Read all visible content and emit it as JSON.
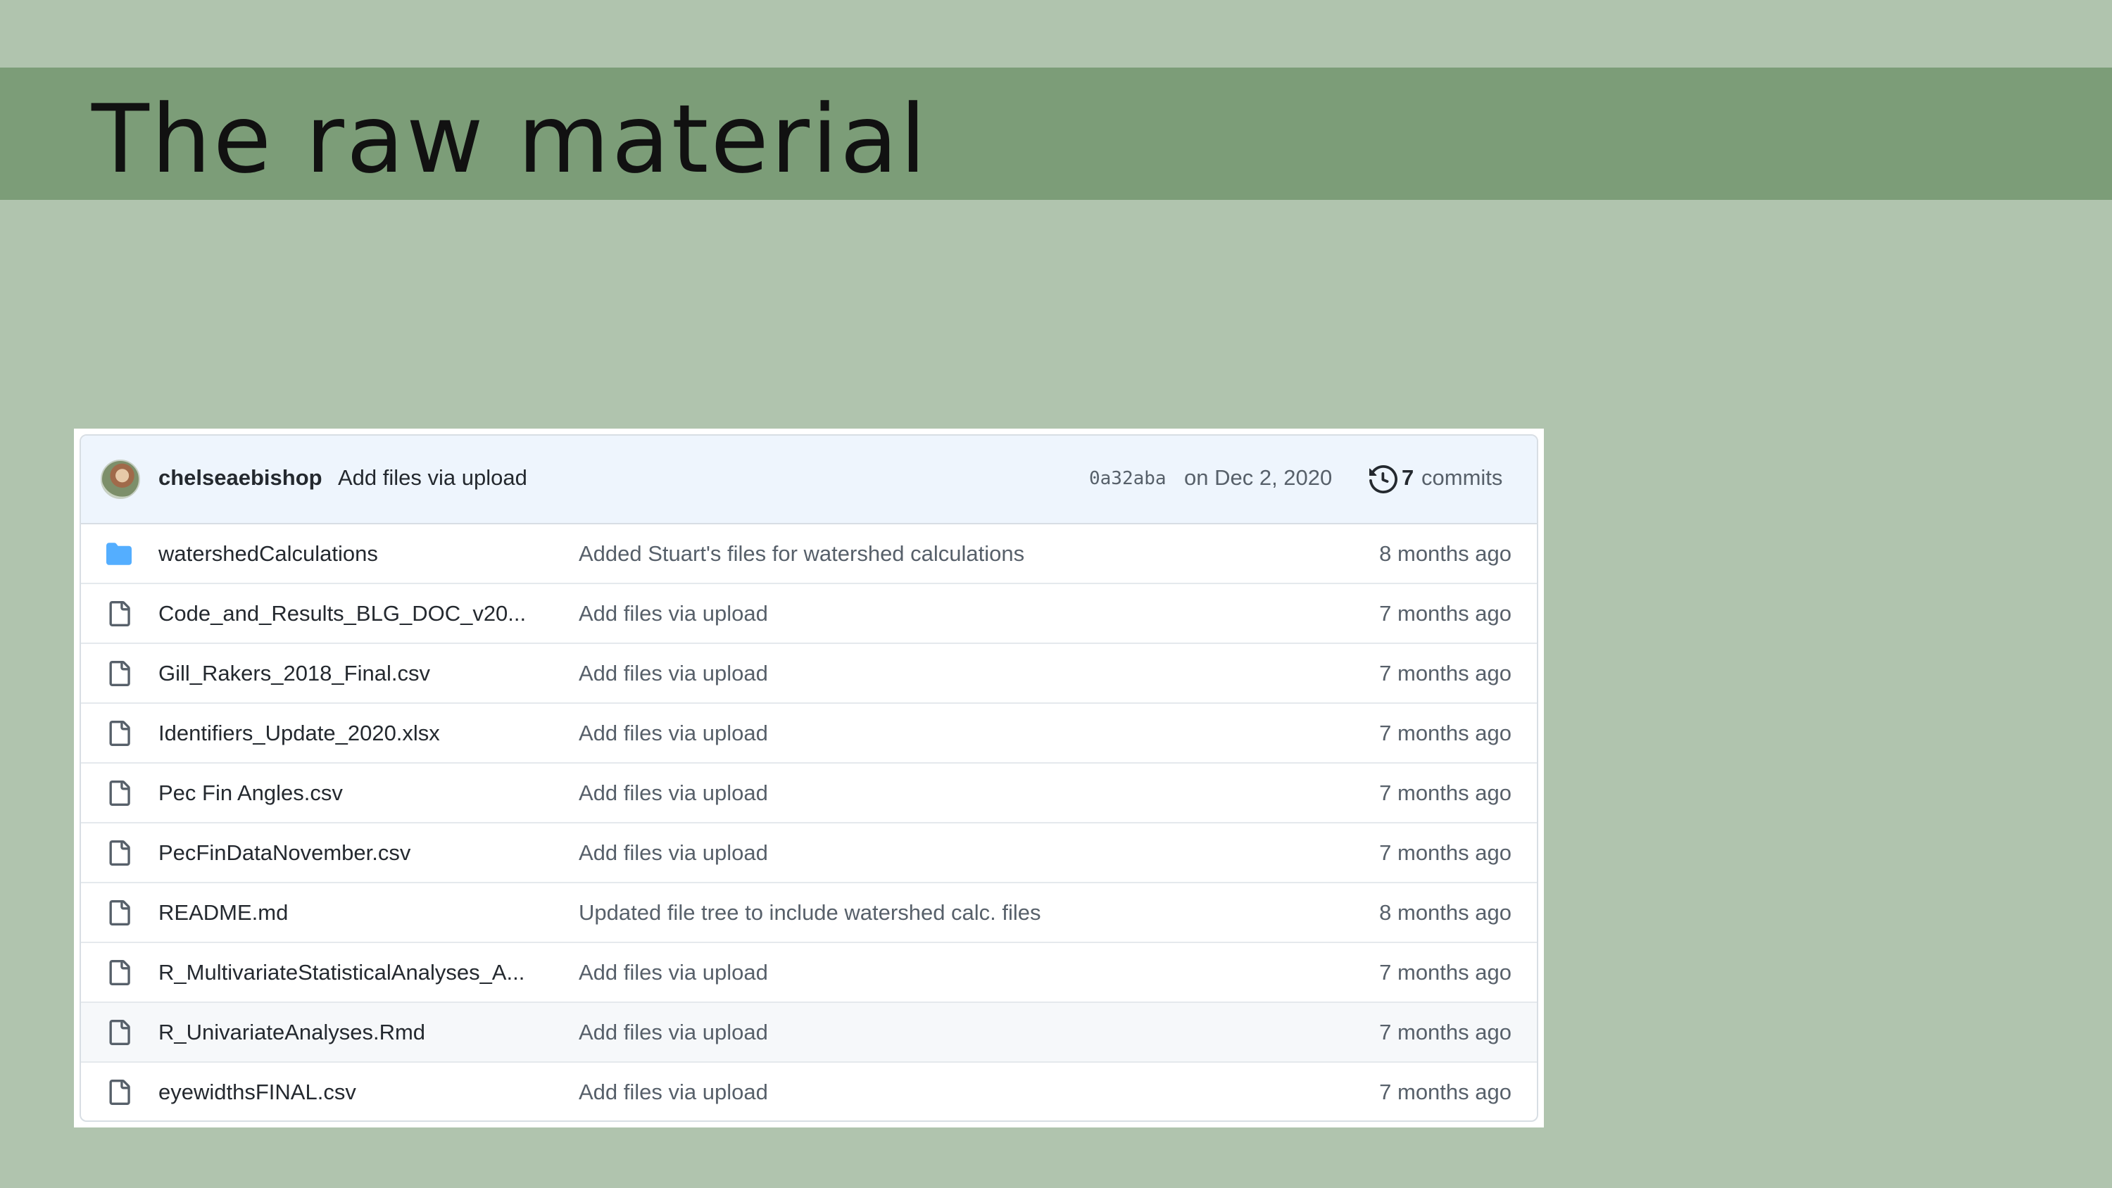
{
  "slide": {
    "title": "The raw material"
  },
  "commit": {
    "author": "chelseaebishop",
    "message": "Add files via upload",
    "hash": "0a32aba",
    "date": "on Dec 2, 2020",
    "commit_count": "7",
    "commit_count_label": "commits"
  },
  "files": [
    {
      "name": "watershedCalculations",
      "type": "folder",
      "message": "Added Stuart's files for watershed calculations",
      "age": "8 months ago"
    },
    {
      "name": "Code_and_Results_BLG_DOC_v20...",
      "type": "file",
      "message": "Add files via upload",
      "age": "7 months ago"
    },
    {
      "name": "Gill_Rakers_2018_Final.csv",
      "type": "file",
      "message": "Add files via upload",
      "age": "7 months ago"
    },
    {
      "name": "Identifiers_Update_2020.xlsx",
      "type": "file",
      "message": "Add files via upload",
      "age": "7 months ago"
    },
    {
      "name": "Pec Fin Angles.csv",
      "type": "file",
      "message": "Add files via upload",
      "age": "7 months ago"
    },
    {
      "name": "PecFinDataNovember.csv",
      "type": "file",
      "message": "Add files via upload",
      "age": "7 months ago"
    },
    {
      "name": "README.md",
      "type": "file",
      "message": "Updated file tree to include watershed calc. files",
      "age": "8 months ago"
    },
    {
      "name": "R_MultivariateStatisticalAnalyses_A...",
      "type": "file",
      "message": "Add files via upload",
      "age": "7 months ago"
    },
    {
      "name": "R_UnivariateAnalyses.Rmd",
      "type": "file",
      "message": "Add files via upload",
      "age": "7 months ago"
    },
    {
      "name": "eyewidthsFINAL.csv",
      "type": "file",
      "message": "Add files via upload",
      "age": "7 months ago"
    }
  ],
  "colors": {
    "folder": "#54aeff",
    "file_icon": "#57606a"
  }
}
